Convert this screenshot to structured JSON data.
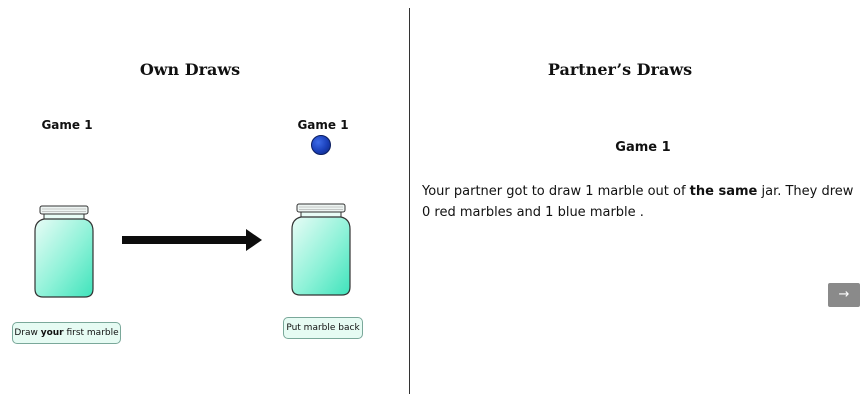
{
  "own_draws": {
    "heading": "Own Draws",
    "game_label_left": "Game 1",
    "game_label_right": "Game 1",
    "draw_button": {
      "prefix": "Draw ",
      "bold": "your",
      "suffix": " first marble"
    },
    "put_back_button": "Put marble back",
    "drawn_marble_color": "#1a3fb8"
  },
  "partner_draws": {
    "heading": "Partner’s Draws",
    "game_label": "Game 1",
    "text": {
      "part1": "Your partner got to draw 1 marble out of ",
      "bold": "the same",
      "part2": " jar. They drew 0 red marbles and 1 blue marble ."
    }
  },
  "navigation": {
    "next_label": "→"
  },
  "colors": {
    "jar_fill": "#5fe8c6",
    "button_bg": "#e6fbf3",
    "next_bg": "#8a8a8a"
  }
}
